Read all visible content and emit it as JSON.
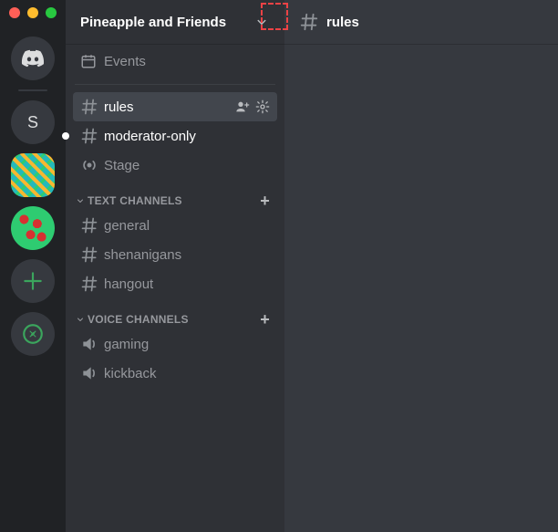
{
  "server": {
    "name": "Pineapple and Friends"
  },
  "events": {
    "label": "Events"
  },
  "top_channels": [
    {
      "name": "rules",
      "type": "text",
      "selected": true,
      "white": true
    },
    {
      "name": "moderator-only",
      "type": "text",
      "white": true,
      "unread": true
    },
    {
      "name": "Stage",
      "type": "stage"
    }
  ],
  "categories": [
    {
      "label": "TEXT CHANNELS",
      "channels": [
        {
          "name": "general",
          "type": "text"
        },
        {
          "name": "shenanigans",
          "type": "text"
        },
        {
          "name": "hangout",
          "type": "text"
        }
      ]
    },
    {
      "label": "VOICE CHANNELS",
      "channels": [
        {
          "name": "gaming",
          "type": "voice"
        },
        {
          "name": "kickback",
          "type": "voice"
        }
      ]
    }
  ],
  "main": {
    "channel_name": "rules"
  },
  "guild_rail": {
    "letter": "S"
  }
}
